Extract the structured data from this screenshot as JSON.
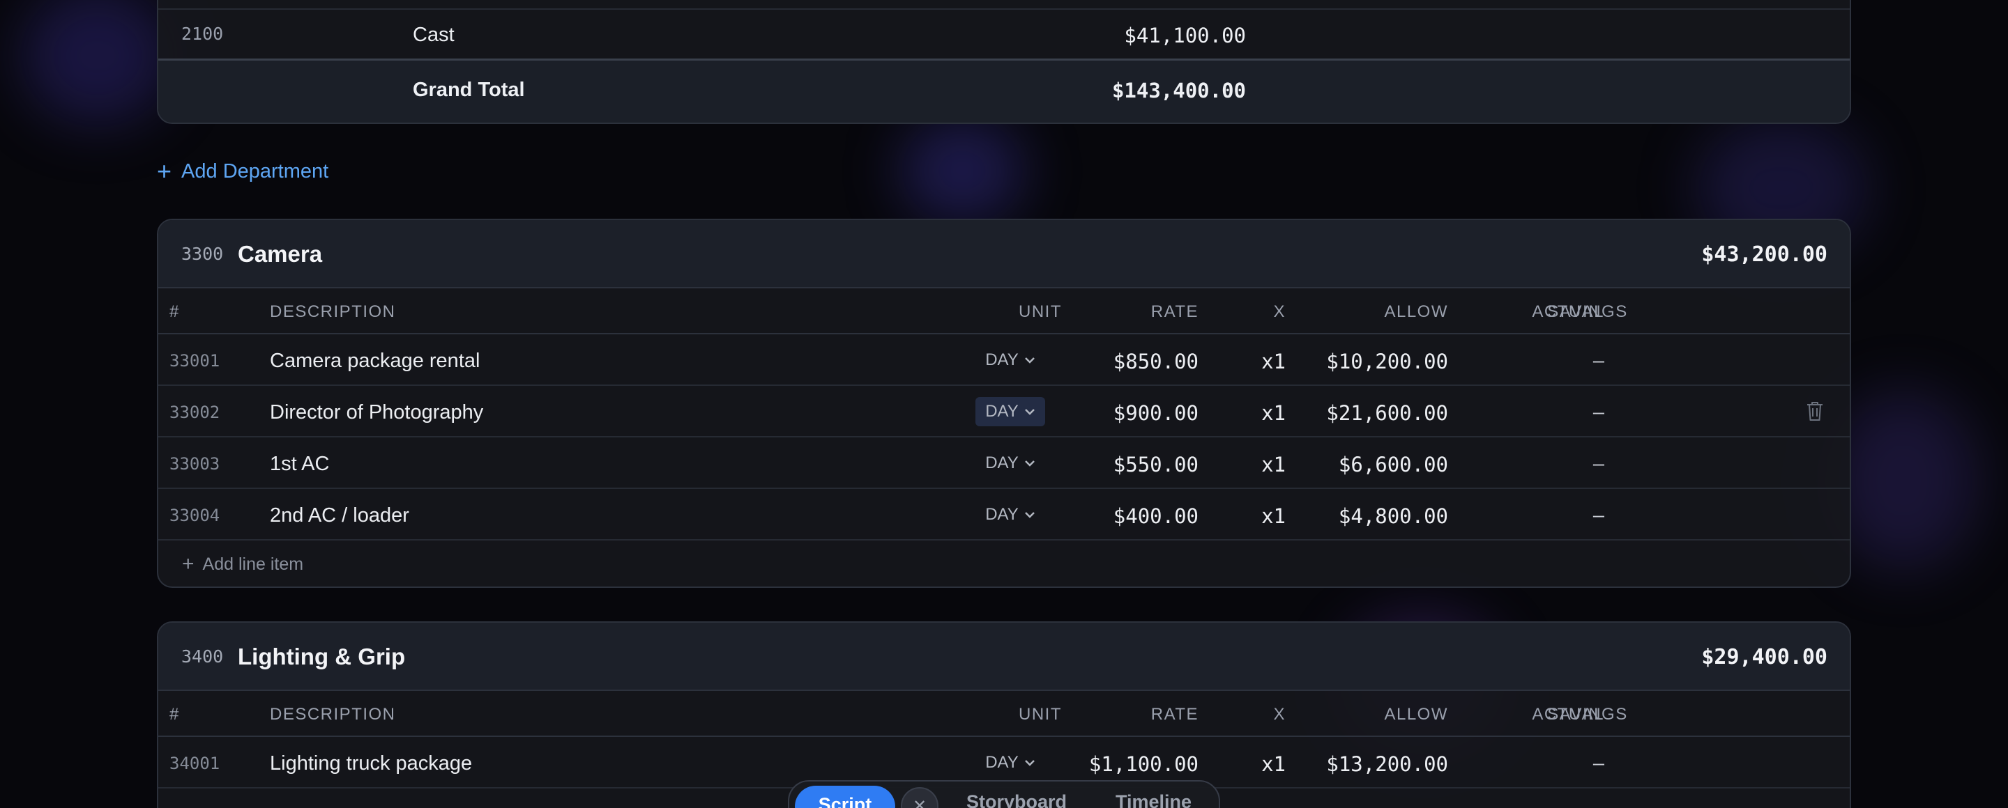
{
  "summary": {
    "cast": {
      "code": "2100",
      "label": "Cast",
      "amount": "$41,100.00"
    },
    "grand_total": {
      "label": "Grand Total",
      "amount": "$143,400.00"
    }
  },
  "add_department": {
    "icon": "plus-icon",
    "label": "Add Department"
  },
  "columns": {
    "num": "#",
    "description": "DESCRIPTION",
    "unit": "UNIT",
    "rate": "RATE",
    "x": "X",
    "allow": "ALLOW",
    "actual": "ACTUAL",
    "savings": "SAVINGS"
  },
  "departments": [
    {
      "code": "3300",
      "name": "Camera",
      "total": "$43,200.00",
      "items": [
        {
          "num": "33001",
          "description": "Camera package rental",
          "unit": "DAY",
          "rate": "$850.00",
          "x": "x1",
          "allow": "$10,200.00",
          "actual": "–"
        },
        {
          "num": "33002",
          "description": "Director of Photography",
          "unit": "DAY",
          "rate": "$900.00",
          "x": "x1",
          "allow": "$21,600.00",
          "actual": "–"
        },
        {
          "num": "33003",
          "description": "1st AC",
          "unit": "DAY",
          "rate": "$550.00",
          "x": "x1",
          "allow": "$6,600.00",
          "actual": "–"
        },
        {
          "num": "33004",
          "description": "2nd AC / loader",
          "unit": "DAY",
          "rate": "$400.00",
          "x": "x1",
          "allow": "$4,800.00",
          "actual": "–"
        }
      ],
      "add_line_label": "Add line item"
    },
    {
      "code": "3400",
      "name": "Lighting & Grip",
      "total": "$29,400.00",
      "items": [
        {
          "num": "34001",
          "description": "Lighting truck package",
          "unit": "DAY",
          "rate": "$1,100.00",
          "x": "x1",
          "allow": "$13,200.00",
          "actual": "–"
        }
      ]
    }
  ],
  "view_switcher": {
    "tabs": [
      "Script",
      "Storyboard",
      "Timeline"
    ],
    "active": "Script",
    "close_icon": "close-icon"
  },
  "colors": {
    "accent": "#5ea6f4",
    "active_tab": "#2f7cf3",
    "background": "#07070c"
  }
}
